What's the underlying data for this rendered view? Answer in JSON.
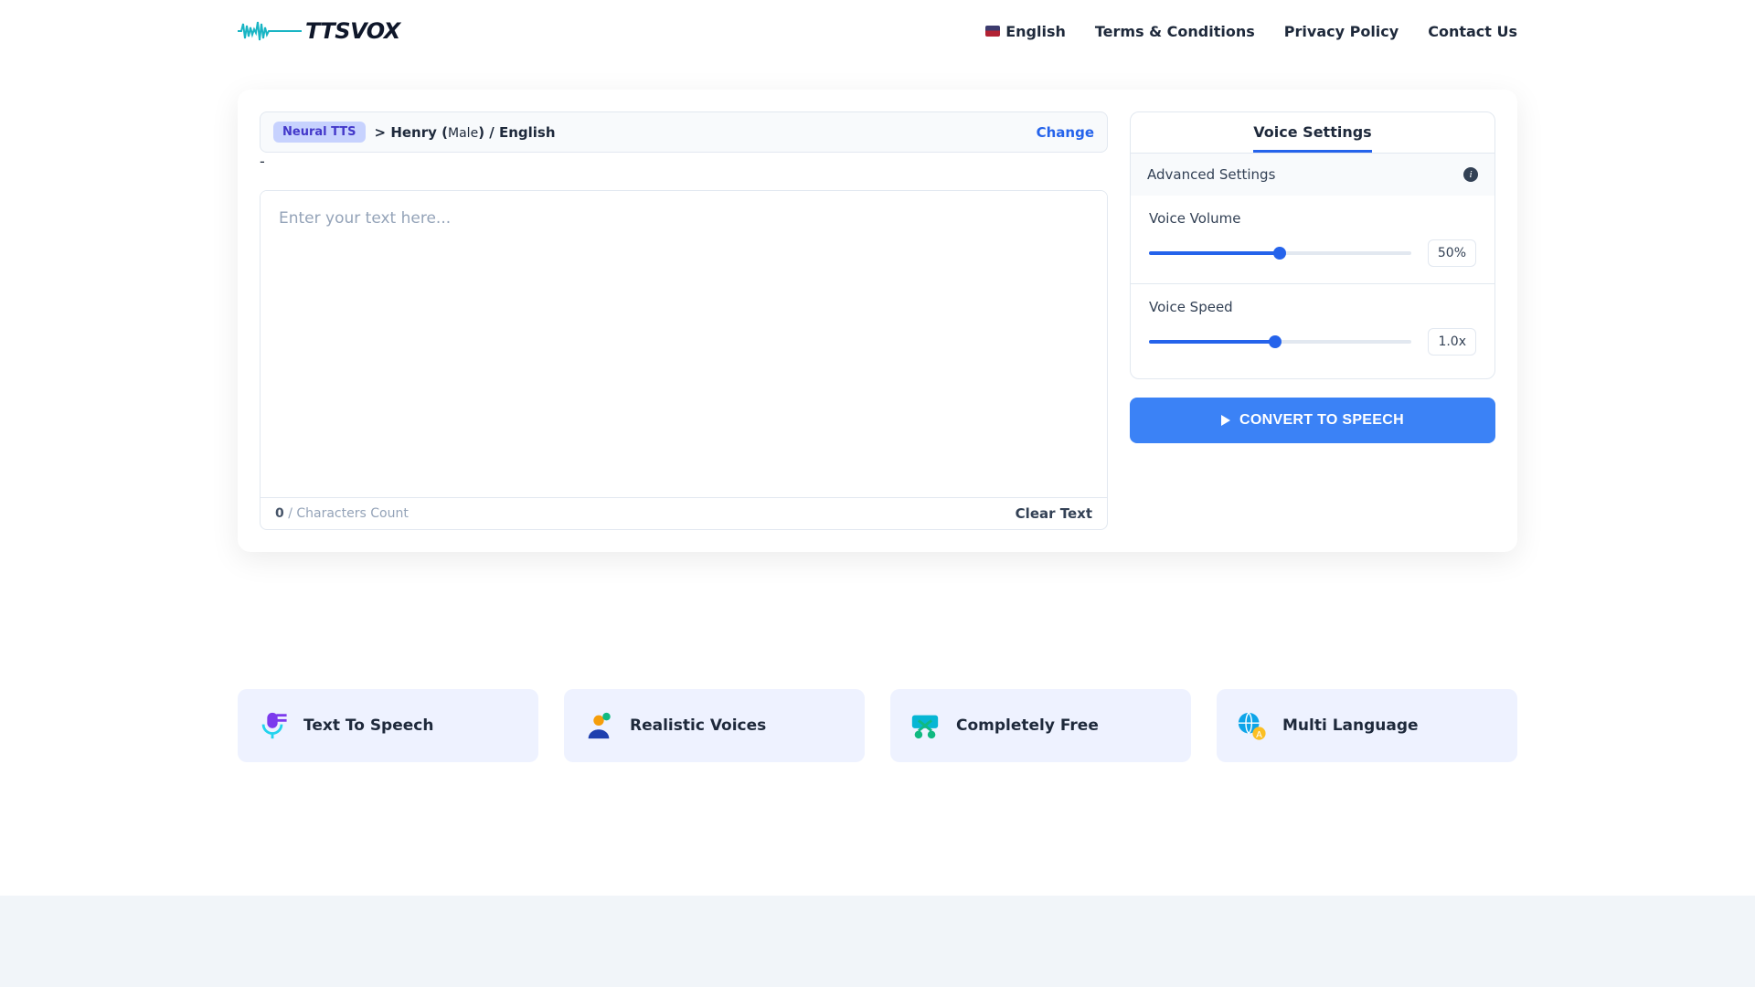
{
  "logo": {
    "text": "TTSVOX"
  },
  "nav": {
    "language": "English",
    "terms": "Terms & Conditions",
    "privacy": "Privacy Policy",
    "contact": "Contact Us"
  },
  "voiceSelector": {
    "badge": "Neural TTS",
    "separator": ">",
    "name": "Henry",
    "gender": "Male",
    "language": "English",
    "change": "Change"
  },
  "editor": {
    "placeholder": "Enter your text here...",
    "count": "0",
    "countSuffix": "/ Characters Count",
    "clear": "Clear Text"
  },
  "settings": {
    "tab": "Voice Settings",
    "advanced": "Advanced Settings",
    "volume": {
      "label": "Voice Volume",
      "value": "50%",
      "percent": 50
    },
    "speed": {
      "label": "Voice Speed",
      "value": "1.0x",
      "percent": 48
    }
  },
  "convert": "CONVERT TO SPEECH",
  "features": [
    {
      "title": "Text To Speech",
      "icon": "mic-icon"
    },
    {
      "title": "Realistic Voices",
      "icon": "person-icon"
    },
    {
      "title": "Completely Free",
      "icon": "scissors-icon"
    },
    {
      "title": "Multi Language",
      "icon": "globe-icon"
    }
  ]
}
